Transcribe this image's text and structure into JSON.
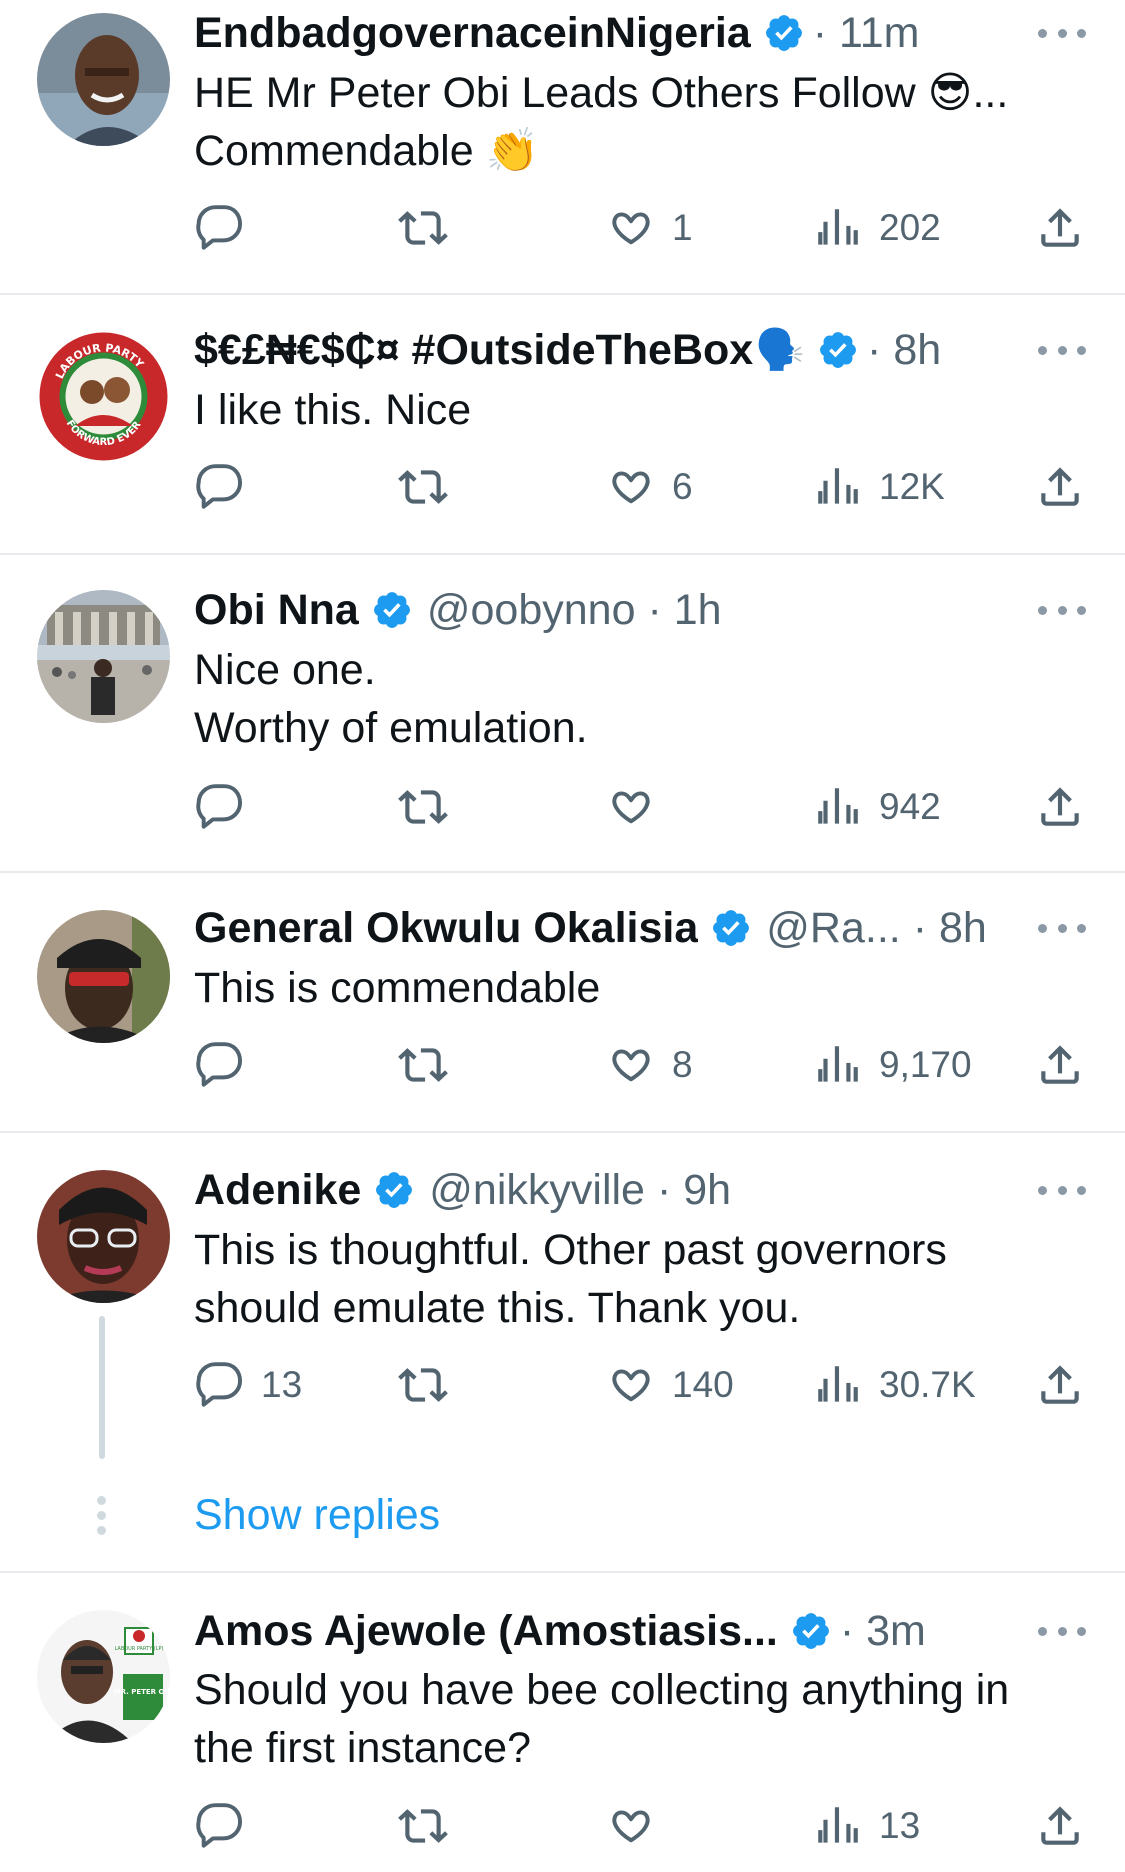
{
  "tweets": [
    {
      "name": "EndbadgovernaceinNigeria",
      "handle": "",
      "time": "11m",
      "name_emoji": "",
      "text": "HE Mr Peter Obi Leads Others Follow 😎...\nCommendable 👏",
      "reply_count": "",
      "like_count": "1",
      "view_count": "202"
    },
    {
      "name": "$€£₦€$₵¤ #OutsideTheBox",
      "handle": "",
      "time": "8h",
      "name_emoji": "🗣️",
      "avatar_text_top": "LABOUR PARTY",
      "avatar_text_bottom": "FORWARD EVER",
      "text": "I like this. Nice",
      "reply_count": "",
      "like_count": "6",
      "view_count": "12K"
    },
    {
      "name": "Obi Nna",
      "handle": "@oobynno",
      "time": "1h",
      "name_emoji": "",
      "text": "Nice one.\nWorthy of emulation.",
      "reply_count": "",
      "like_count": "",
      "view_count": "942"
    },
    {
      "name": "General Okwulu Okalisia",
      "handle": "@Ra...",
      "time": "8h",
      "name_emoji": "",
      "text": "This is commendable",
      "reply_count": "",
      "like_count": "8",
      "view_count": "9,170"
    },
    {
      "name": "Adenike",
      "handle": "@nikkyville",
      "time": "9h",
      "name_emoji": "",
      "text": "This is thoughtful. Other past governors\nshould emulate this. Thank you.",
      "reply_count": "13",
      "like_count": "140",
      "view_count": "30.7K"
    },
    {
      "name": "Amos Ajewole (Amostiasis...",
      "handle": "",
      "time": "3m",
      "name_emoji": "",
      "avatar_text_party": "LABOUR PARTY (LP)",
      "avatar_text_name": "MR. PETER OBI",
      "text": "Should you have bee collecting anything in\nthe first instance?",
      "reply_count": "",
      "like_count": "",
      "view_count": "13"
    }
  ],
  "show_replies_label": "Show replies",
  "meta_separator": "·",
  "icons": {
    "reply": "reply-icon",
    "retweet": "retweet-icon",
    "like": "like-icon",
    "views": "views-icon",
    "share": "share-icon",
    "verified": "verified-badge-icon",
    "more": "more-icon"
  },
  "colors": {
    "text": "#0f1419",
    "secondary": "#536471",
    "accent": "#1d9bf0",
    "divider": "#e7e9ec",
    "verified": "#1d9bf0"
  }
}
